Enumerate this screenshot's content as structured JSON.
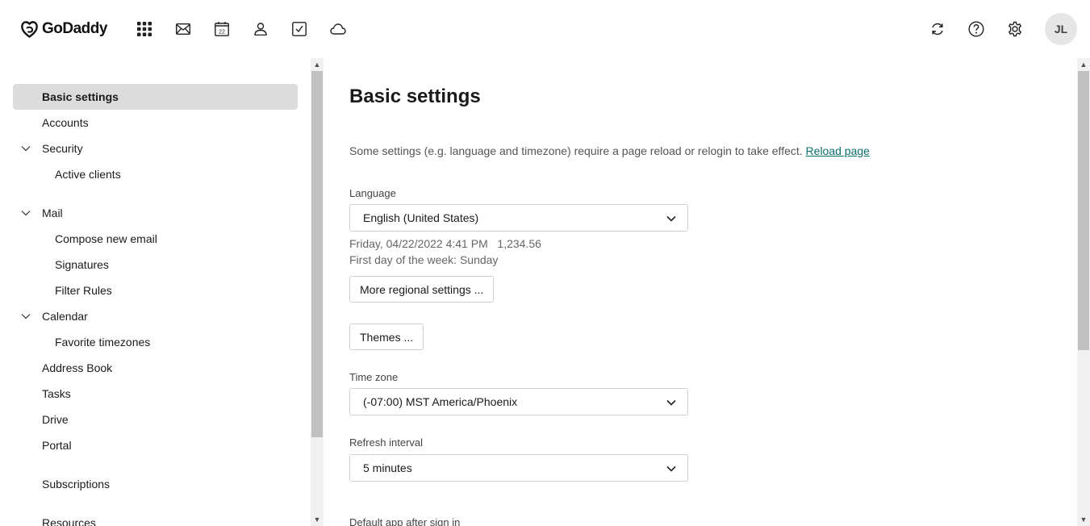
{
  "header": {
    "brand": "GoDaddy",
    "apps": [
      {
        "icon": "app-grid-icon"
      },
      {
        "icon": "mail-icon"
      },
      {
        "icon": "calendar-icon",
        "text": "22"
      },
      {
        "icon": "contacts-icon"
      },
      {
        "icon": "tasks-icon"
      },
      {
        "icon": "drive-cloud-icon"
      }
    ],
    "actions": [
      {
        "icon": "refresh-icon"
      },
      {
        "icon": "help-icon"
      },
      {
        "icon": "gear-icon"
      }
    ],
    "avatar_initials": "JL"
  },
  "sidebar": {
    "items": [
      {
        "label": "Basic settings",
        "active": true
      },
      {
        "label": "Accounts"
      },
      {
        "label": "Security",
        "expanded": true
      },
      {
        "label": "Active clients",
        "child": true
      },
      {
        "label": "Mail",
        "expanded": true
      },
      {
        "label": "Compose new email",
        "child": true
      },
      {
        "label": "Signatures",
        "child": true
      },
      {
        "label": "Filter Rules",
        "child": true
      },
      {
        "label": "Calendar",
        "expanded": true
      },
      {
        "label": "Favorite timezones",
        "child": true
      },
      {
        "label": "Address Book"
      },
      {
        "label": "Tasks"
      },
      {
        "label": "Drive"
      },
      {
        "label": "Portal"
      },
      {
        "label": "Subscriptions"
      },
      {
        "label": "Resources"
      }
    ]
  },
  "main": {
    "title": "Basic settings",
    "hint": "Some settings (e.g. language and timezone) require a page reload or relogin to take effect.",
    "reload_link": "Reload page",
    "language": {
      "label": "Language",
      "value": "English (United States)"
    },
    "regional_preview": "Friday, 04/22/2022 4:41 PM   1,234.56",
    "first_day": "First day of the week: Sunday",
    "more_regional_button": "More regional settings ...",
    "themes_button": "Themes ...",
    "timezone": {
      "label": "Time zone",
      "value": "(-07:00) MST America/Phoenix"
    },
    "refresh": {
      "label": "Refresh interval",
      "value": "5 minutes"
    },
    "default_app": {
      "label": "Default app after sign in"
    }
  },
  "colors": {
    "link": "#0b6e6e",
    "active_nav_bg": "#dcdcdc",
    "avatar_bg": "#e6e6e6"
  }
}
